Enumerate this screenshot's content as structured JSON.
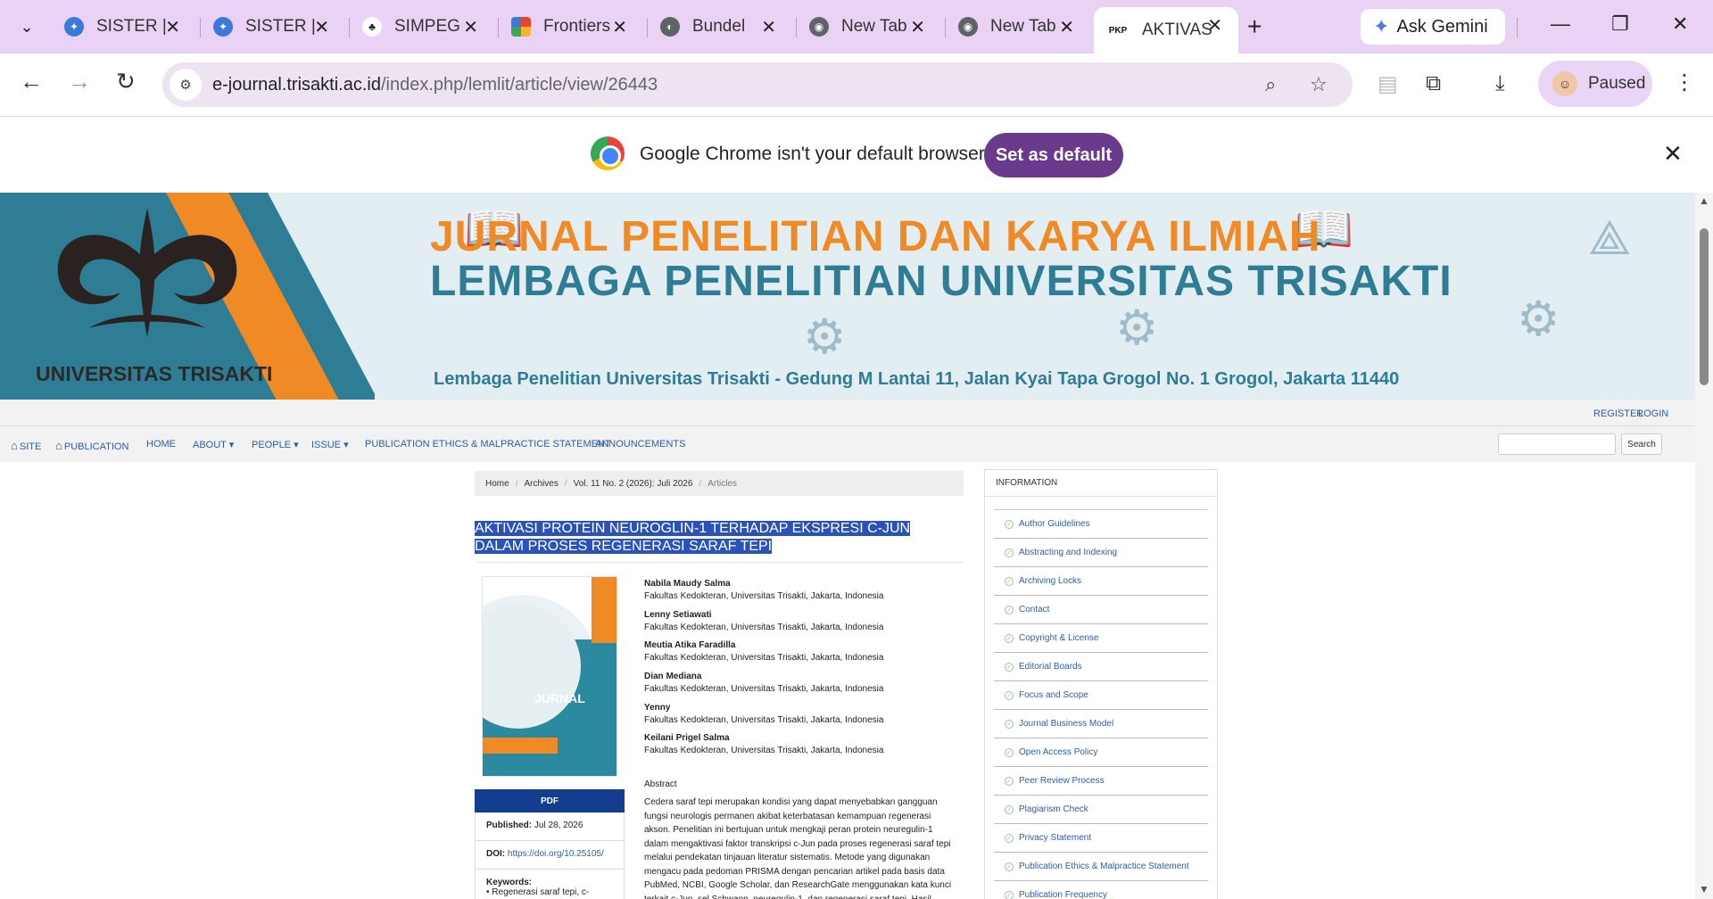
{
  "browser": {
    "tabs": [
      {
        "title": "SISTER |",
        "favicon": "sister-icon",
        "color": "#3b79d8"
      },
      {
        "title": "SISTER |",
        "favicon": "sister-icon",
        "color": "#3b79d8"
      },
      {
        "title": "SIMPEG",
        "favicon": "trisakti-icon",
        "color": "#222222"
      },
      {
        "title": "Frontiers",
        "favicon": "frontiers-icon",
        "color": "#e8462b"
      },
      {
        "title": "Bundel",
        "favicon": "globe-icon",
        "color": "#5f6368"
      },
      {
        "title": "New Tab",
        "favicon": "chrome-icon",
        "color": "#5f6368"
      },
      {
        "title": "New Tab",
        "favicon": "chrome-icon",
        "color": "#5f6368"
      },
      {
        "title": "AKTIVASI",
        "favicon": "pkp-icon",
        "color": "#111111",
        "fav_text": "PKP"
      }
    ],
    "ask_gemini": "Ask Gemini",
    "url_domain": "e-journal.trisakti.ac.id",
    "url_path": "/index.php/lemlit/article/view/26443",
    "profile_status": "Paused",
    "infobar_text": "Google Chrome isn't your default browser",
    "infobar_button": "Set as default"
  },
  "banner": {
    "university": "UNIVERSITAS TRISAKTI",
    "title_line1": "JURNAL PENELITIAN DAN KARYA ILMIAH",
    "title_line2": "LEMBAGA PENELITIAN UNIVERSITAS TRISAKTI",
    "address": "Lembaga Penelitian Universitas Trisakti - Gedung M Lantai 11, Jalan Kyai Tapa Grogol No. 1 Grogol, Jakarta 11440"
  },
  "usernav": {
    "register": "REGISTER",
    "login": "LOGIN"
  },
  "mainnav": {
    "site": "SITE",
    "publication": "PUBLICATION",
    "home": "HOME",
    "about": "ABOUT ▾",
    "people": "PEOPLE ▾",
    "issue": "ISSUE ▾",
    "ethics": "PUBLICATION ETHICS & MALPRACTICE STATEMENT",
    "announcements": "ANNOUNCEMENTS",
    "search_button": "Search"
  },
  "breadcrumb": {
    "home": "Home",
    "archives": "Archives",
    "issue": "Vol. 11 No. 2 (2026): Juli 2026",
    "current": "Articles"
  },
  "article": {
    "title": "AKTIVASI PROTEIN NEUROGLIN-1 TERHADAP EKSPRESI C-JUN DALAM PROSES REGENERASI SARAF TEPI",
    "cover_title": "JURNAL",
    "pdf_label": "PDF",
    "published_label": "Published:",
    "published_value": "Jul 28, 2026",
    "doi_label": "DOI:",
    "doi_value": "https://doi.org/10.25105/",
    "keywords_label": "Keywords:",
    "keywords_value": "• Regenerasi saraf tepi, c-",
    "authors": [
      {
        "name": "Nabila Maudy Salma",
        "affil": "Fakultas Kedokteran, Universitas Trisakti, Jakarta, Indonesia"
      },
      {
        "name": "Lenny Setiawati",
        "affil": "Fakultas Kedokteran, Universitas Trisakti, Jakarta, Indonesia"
      },
      {
        "name": "Meutia Atika Faradilla",
        "affil": "Fakultas Kedokteran, Universitas Trisakti, Jakarta, Indonesia"
      },
      {
        "name": "Dian Mediana",
        "affil": "Fakultas Kedokteran, Universitas Trisakti, Jakarta, Indonesia"
      },
      {
        "name": "Yenny",
        "affil": "Fakultas Kedokteran, Universitas Trisakti, Jakarta, Indonesia"
      },
      {
        "name": "Keilani Prigel Salma",
        "affil": "Fakultas Kedokteran, Universitas Trisakti, Jakarta, Indonesia"
      }
    ],
    "abstract_heading": "Abstract",
    "abstract_text": "Cedera saraf tepi merupakan kondisi yang dapat menyebabkan gangguan fungsi neurologis permanen akibat keterbatasan kemampuan regenerasi akson. Penelitian ini bertujuan untuk mengkaji peran protein neuregulin-1 dalam mengaktivasi faktor transkripsi c-Jun pada proses regenerasi saraf tepi melalui pendekatan tinjauan literatur sistematis. Metode yang digunakan mengacu pada pedoman PRISMA dengan pencarian artikel pada basis data PubMed, NCBI, Google Scholar, dan ResearchGate menggunakan kata kunci terkait c-Jun, sel Schwann, neuregulin-1, dan regenerasi saraf tepi. Hasil"
  },
  "sidebar": {
    "heading": "INFORMATION",
    "items": [
      "Author Guidelines",
      "Abstracting and Indexing",
      "Archiving Locks",
      "Contact",
      "Copyright & License",
      "Editorial Boards",
      "Focus and Scope",
      "Journal Business Model",
      "Open Access Policy",
      "Peer Review Process",
      "Plagiarism Check",
      "Privacy Statement",
      "Publication Ethics & Malpractice Statement",
      "Publication Frequency"
    ]
  }
}
